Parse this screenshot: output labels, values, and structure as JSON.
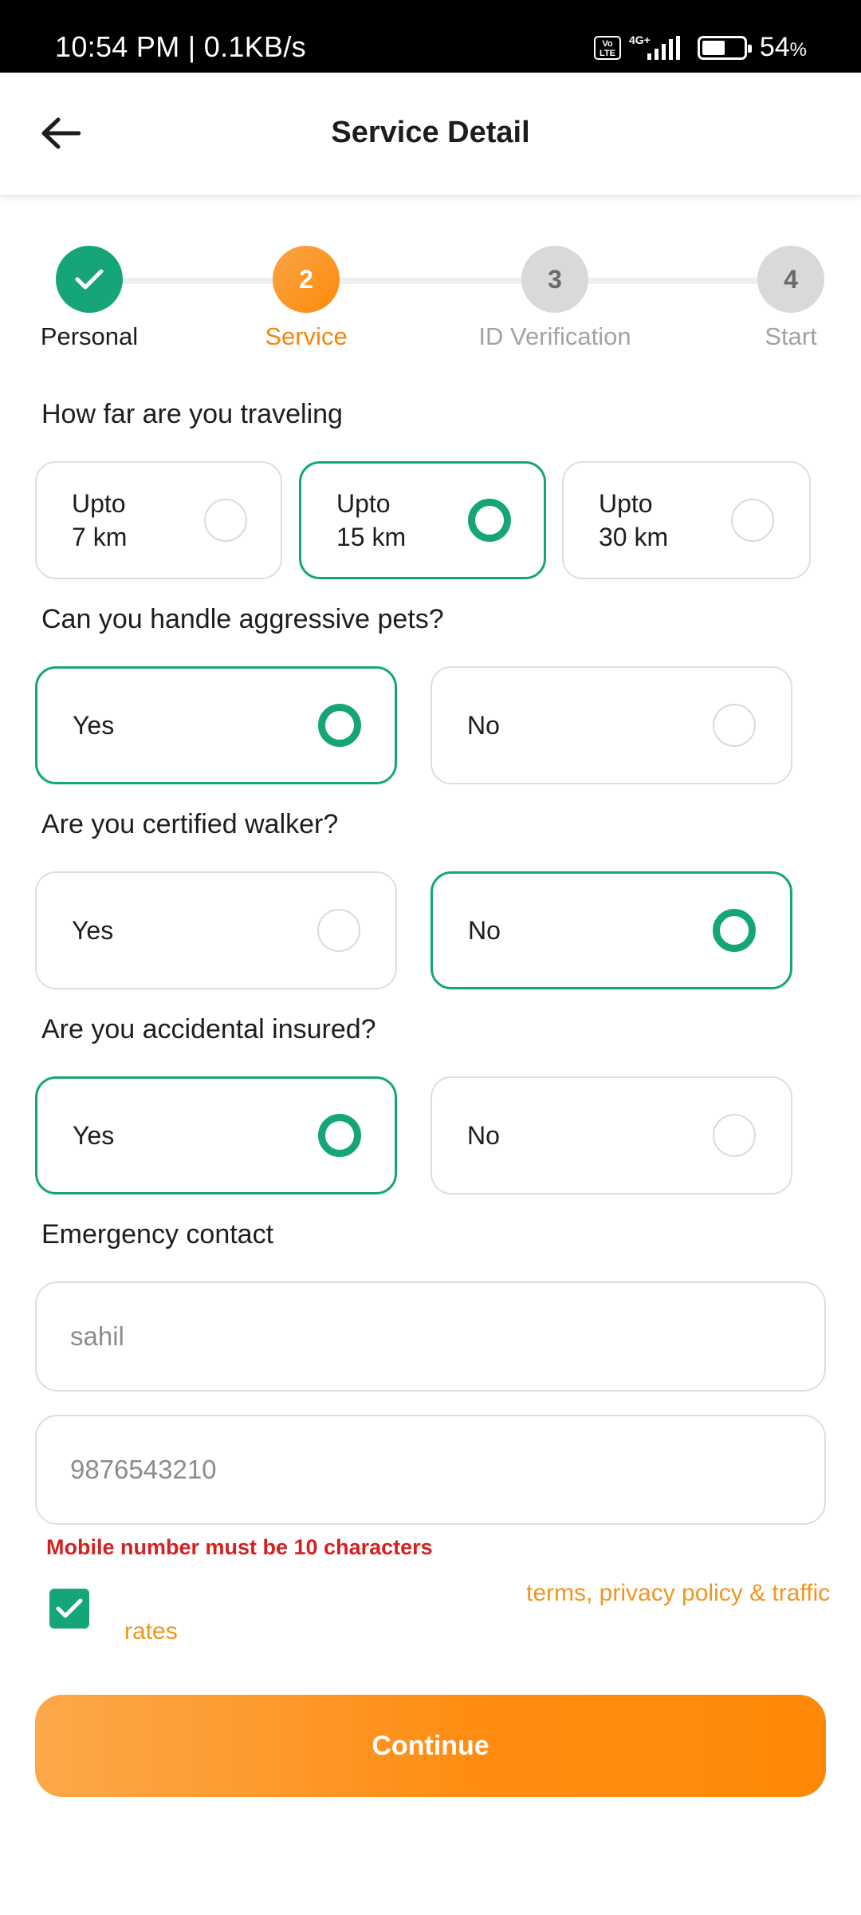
{
  "status_bar": {
    "time": "10:54 PM | 0.1KB/s",
    "volte": "Vo LTE",
    "network": "4G+",
    "battery_percent": "54",
    "battery_unit": "%",
    "battery_level": 0.54
  },
  "header": {
    "title": "Service Detail"
  },
  "stepper": {
    "steps": [
      {
        "number": "1",
        "label": "Personal",
        "state": "done"
      },
      {
        "number": "2",
        "label": "Service",
        "state": "active"
      },
      {
        "number": "3",
        "label": "ID Verification",
        "state": "todo"
      },
      {
        "number": "4",
        "label": "Start",
        "state": "todo"
      }
    ]
  },
  "questions": [
    {
      "label": "How far are you traveling",
      "options": [
        {
          "line1": "Upto",
          "line2": "7 km",
          "selected": false
        },
        {
          "line1": "Upto",
          "line2": "15 km",
          "selected": true
        },
        {
          "line1": "Upto",
          "line2": "30 km",
          "selected": false
        }
      ]
    },
    {
      "label": "Can you handle aggressive pets?",
      "options": [
        {
          "label": "Yes",
          "selected": true
        },
        {
          "label": "No",
          "selected": false
        }
      ]
    },
    {
      "label": "Are you certified walker?",
      "options": [
        {
          "label": "Yes",
          "selected": false
        },
        {
          "label": "No",
          "selected": true
        }
      ]
    },
    {
      "label": "Are you accidental insured?",
      "options": [
        {
          "label": "Yes",
          "selected": true
        },
        {
          "label": "No",
          "selected": false
        }
      ]
    }
  ],
  "emergency": {
    "label": "Emergency contact",
    "name_value": "sahil",
    "phone_value": "9876543210",
    "error": "Mobile number must be 10 characters"
  },
  "terms": {
    "checked": true,
    "text_line1": "terms, privacy policy & traffic",
    "text_line2": "rates"
  },
  "continue_label": "Continue",
  "colors": {
    "accent_green": "#15a579",
    "accent_orange": "#ff8a0a",
    "error_red": "#d71f1f"
  }
}
